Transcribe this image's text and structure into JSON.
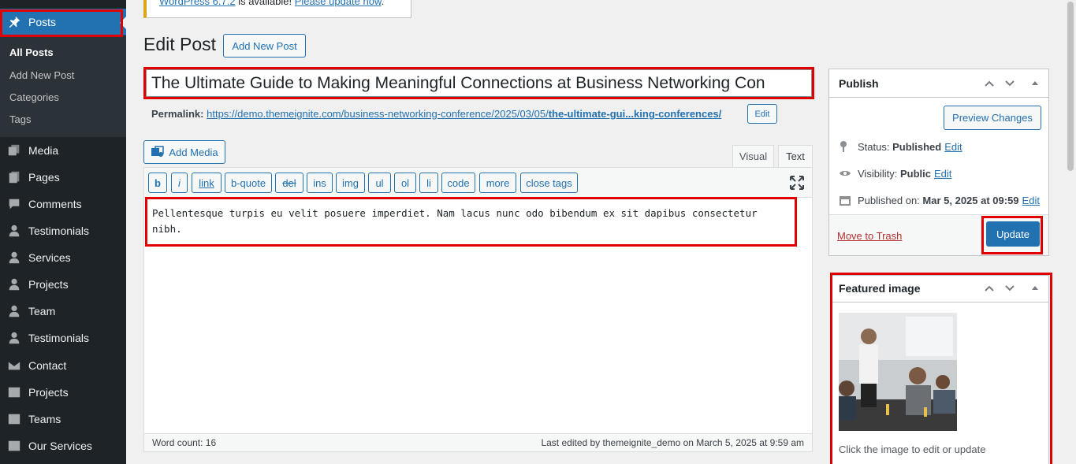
{
  "sidebar": {
    "posts_label": "Posts",
    "submenu": [
      "All Posts",
      "Add New Post",
      "Categories",
      "Tags"
    ],
    "items": [
      "Media",
      "Pages",
      "Comments",
      "Testimonials",
      "Services",
      "Projects",
      "Team",
      "Testimonials",
      "Contact",
      "Projects",
      "Teams",
      "Our Services"
    ]
  },
  "notice": {
    "version_link": "WordPress 6.7.2",
    "middle": " is available! ",
    "update_link": "Please update now",
    "end": "."
  },
  "header": {
    "title": "Edit Post",
    "add_new": "Add New Post"
  },
  "post": {
    "title": "The Ultimate Guide to Making Meaningful Connections at Business Networking Con",
    "permalink_label": "Permalink:",
    "permalink_base": "https://demo.themeignite.com/business-networking-conference/2025/03/05/",
    "permalink_slug": "the-ultimate-gui...king-conferences/",
    "permalink_edit": "Edit",
    "content_line1": "Pellentesque turpis eu velit posuere imperdiet.  Nam lacus nunc odo bibendum ex sit dapibus consectetur",
    "content_line2": "nibh."
  },
  "editor": {
    "add_media": "Add Media",
    "tab_visual": "Visual",
    "tab_text": "Text",
    "buttons": [
      "b",
      "i",
      "link",
      "b-quote",
      "del",
      "ins",
      "img",
      "ul",
      "ol",
      "li",
      "code",
      "more",
      "close tags"
    ],
    "word_count": "Word count: 16",
    "last_edited": "Last edited by themeignite_demo on March 5, 2025 at 9:59 am"
  },
  "publish": {
    "title": "Publish",
    "preview": "Preview Changes",
    "status_label": "Status:",
    "status_value": "Published",
    "visibility_label": "Visibility:",
    "visibility_value": "Public",
    "published_label": "Published on:",
    "published_value": "Mar 5, 2025 at 09:59",
    "edit": "Edit",
    "trash": "Move to Trash",
    "update": "Update"
  },
  "featured": {
    "title": "Featured image",
    "hint": "Click the image to edit or update"
  },
  "colors": {
    "accent": "#2271b1",
    "sidebar_bg": "#1d2327",
    "highlight": "#e00000"
  }
}
